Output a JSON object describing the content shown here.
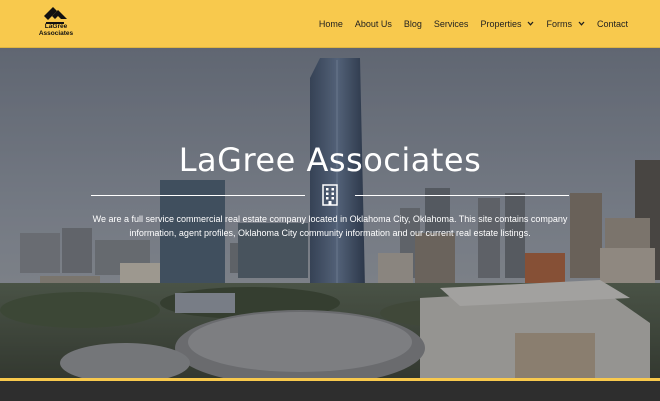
{
  "brand": {
    "logo_text_line1": "LaGree",
    "logo_text_line2": "Associates",
    "accent": "#f8c94d"
  },
  "nav": {
    "items": [
      {
        "label": "Home",
        "dropdown": false
      },
      {
        "label": "About Us",
        "dropdown": false
      },
      {
        "label": "Blog",
        "dropdown": false
      },
      {
        "label": "Services",
        "dropdown": false
      },
      {
        "label": "Properties",
        "dropdown": true
      },
      {
        "label": "Forms",
        "dropdown": true
      },
      {
        "label": "Contact",
        "dropdown": false
      }
    ]
  },
  "hero": {
    "title": "LaGree Associates",
    "icon": "building-icon",
    "description": "We are a full service commercial real estate company located in Oklahoma City, Oklahoma. This site contains company information, agent profiles, Oklahoma City community information and our current real estate listings."
  }
}
